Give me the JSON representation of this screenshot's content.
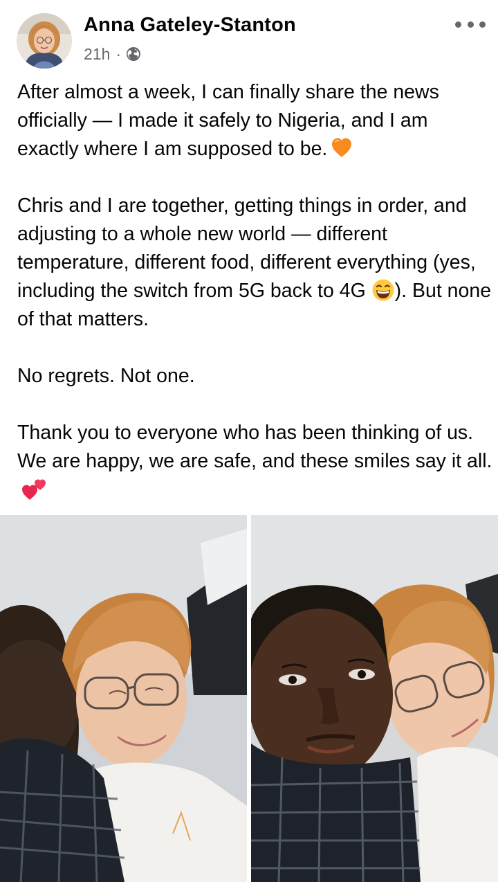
{
  "post": {
    "author_name": "Anna Gateley-Stanton",
    "timestamp": "21h",
    "separator": "·",
    "privacy_icon": "globe-icon",
    "more_icon": "more-options-icon",
    "paragraphs": [
      {
        "text": "After almost a week, I can finally share the news officially — I made it safely to Nigeria, and I am exactly where I am supposed to be.",
        "trailing_emoji": "orange-heart"
      },
      {
        "text": "Chris and I are together, getting things in order, and adjusting to a whole new world — different temperature, different food, different everything (yes, including the switch from 5G back to 4G ",
        "after_emoji_text": "). But none of that matters.",
        "inline_emoji": "grinning-face"
      },
      {
        "text": "No regrets. Not one."
      },
      {
        "text": "Thank you to everyone who has been thinking of us. We are happy, we are safe, and these smiles say it all.",
        "trailing_emoji": "two-hearts"
      }
    ]
  },
  "photos": [
    {
      "name": "photo-left"
    },
    {
      "name": "photo-right"
    }
  ],
  "colors": {
    "text": "#050505",
    "secondary": "#65676b",
    "orange_heart": "#f78b1f",
    "pink_heart": "#e8264d"
  }
}
